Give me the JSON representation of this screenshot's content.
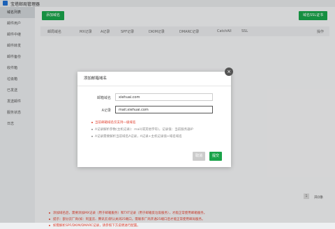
{
  "window": {
    "title": "宝塔邮局管理器"
  },
  "sidebar": {
    "items": [
      {
        "label": "域名列表"
      },
      {
        "label": "邮件用户"
      },
      {
        "label": "邮件中继"
      },
      {
        "label": "邮件转发"
      },
      {
        "label": "邮件备份"
      },
      {
        "label": "收件箱"
      },
      {
        "label": "垃圾箱"
      },
      {
        "label": "已发送"
      },
      {
        "label": "发送邮件"
      },
      {
        "label": "服务状态"
      },
      {
        "label": "日志"
      }
    ]
  },
  "toolbar": {
    "add_domain_label": "添加域名",
    "ssl_label": "域名SSL证书"
  },
  "table": {
    "columns": [
      "邮局域名",
      "MX记录",
      "A记录",
      "SPF记录",
      "DKIM记录",
      "DMARC记录",
      "CatchAll",
      "SSL",
      "操作"
    ]
  },
  "pagination": {
    "current": "1",
    "total_label": "共0条"
  },
  "notes": [
    "添加域名后，需要添加MX记录（用于邮箱服务）和TXT记录（用于邮箱反垃圾服务），才能正常使用邮箱服务。",
    "提示：部分云厂商(如：阿里云、腾讯云)默认关闭25端口，需联系厂商开通25端口后才能正常使用邮局服务。",
    "如需解析SPF/DKIM/DMARC记录，请参照下方说明进行配置。"
  ],
  "dialog": {
    "title": "添加邮箱域名",
    "domain_label": "邮箱域名",
    "domain_value": "xiehuai.com",
    "a_record_label": "A记录",
    "a_record_value": "mail.xiehuai.com",
    "tips": [
      "当前邮箱域名仅支持一级域名",
      "A记录解析参数(主机记录)：mail(或其他字符)，记录值：当前服务器IP",
      "A记录需要解析当前域名A记录，A记录+主机记录值+域名域名"
    ],
    "cancel_label": "取消",
    "submit_label": "提交"
  }
}
